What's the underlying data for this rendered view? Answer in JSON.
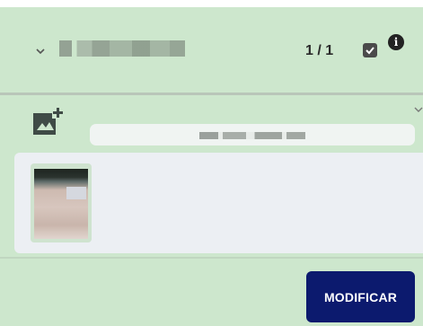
{
  "header": {
    "title": "",
    "counter": "1 / 1",
    "expand_icon": "chevron-down-icon",
    "checkbox_icon": "checkbox-checked-icon",
    "info_icon": "info-icon",
    "info_glyph": "i"
  },
  "section": {
    "add_image_icon": "add-photo-icon",
    "collapse_icon": "chevron-down-icon",
    "filename": "",
    "thumbnail_icon": "image-thumbnail"
  },
  "actions": {
    "modify_label": "MODIFICAR"
  },
  "colors": {
    "background": "#cde7cd",
    "primary_button": "#0c1a6e",
    "panel": "#eceff3"
  }
}
